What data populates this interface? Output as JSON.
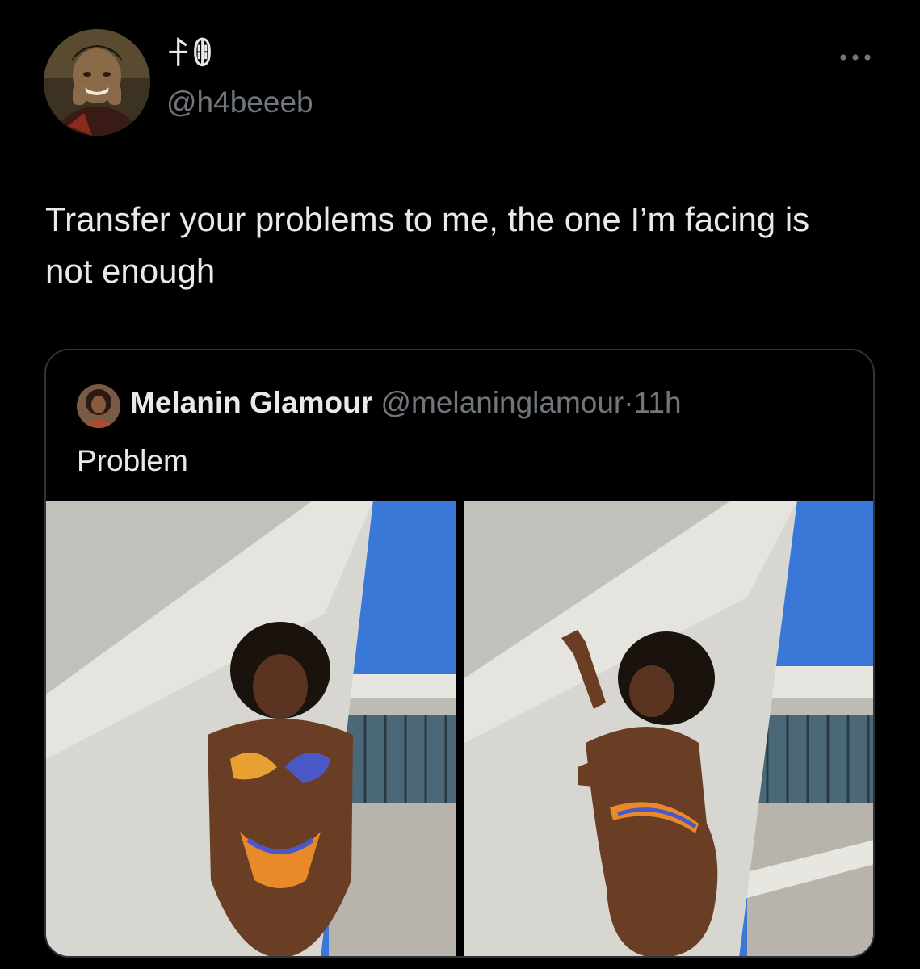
{
  "tweet": {
    "display_name": "ꊰꂦ",
    "handle": "@h4beeeb",
    "text": "Transfer your problems to me, the one I’m facing is not enough",
    "avatar_icon": "profile-photo",
    "more_icon": "more-options-icon"
  },
  "quote": {
    "display_name": "Melanin Glamour",
    "handle": "@melaninglamour",
    "separator": "·",
    "time": "11h",
    "text": "Problem",
    "avatar_icon": "profile-photo",
    "media": [
      {
        "name": "photo-left"
      },
      {
        "name": "photo-right"
      }
    ]
  },
  "colors": {
    "background": "#000000",
    "primary_text": "#e7e9ea",
    "secondary_text": "#71767b",
    "border": "#2f3336",
    "sky": "#3a78d8",
    "wall": "#d8d6d0"
  }
}
